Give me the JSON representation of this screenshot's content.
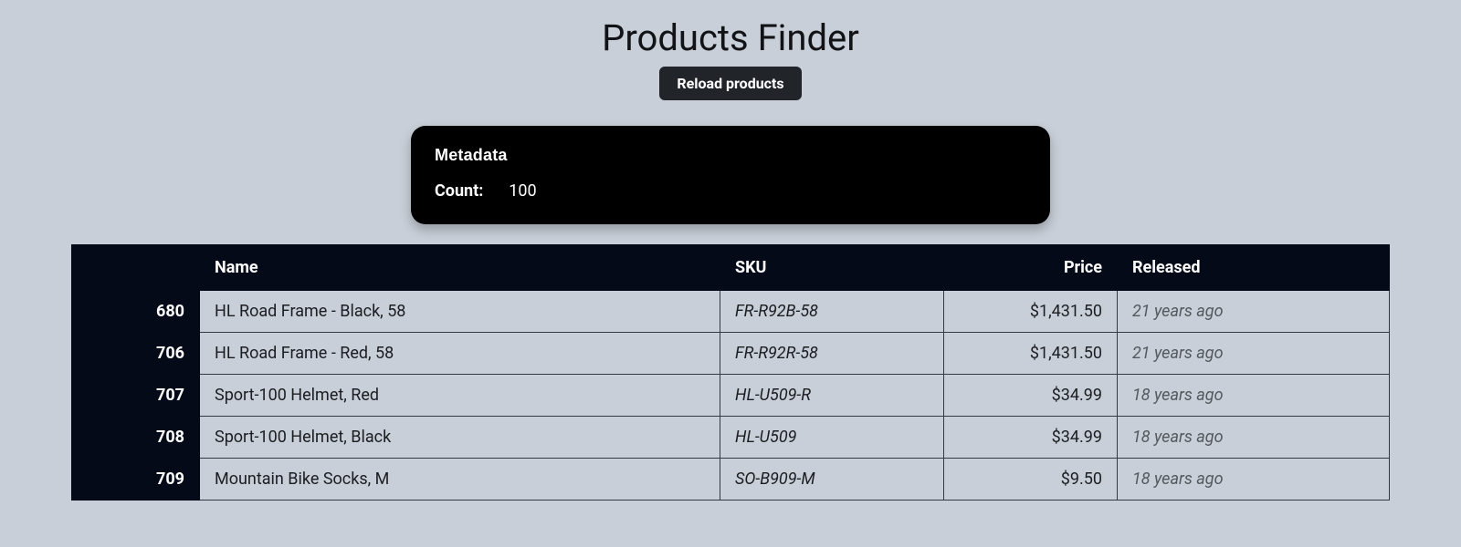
{
  "page": {
    "title": "Products Finder",
    "reload_label": "Reload products"
  },
  "metadata": {
    "heading": "Metadata",
    "count_label": "Count:",
    "count_value": "100"
  },
  "table": {
    "headers": {
      "id": "",
      "name": "Name",
      "sku": "SKU",
      "price": "Price",
      "released": "Released"
    },
    "rows": [
      {
        "id": "680",
        "name": "HL Road Frame - Black, 58",
        "sku": "FR-R92B-58",
        "price": "$1,431.50",
        "released": "21 years ago"
      },
      {
        "id": "706",
        "name": "HL Road Frame - Red, 58",
        "sku": "FR-R92R-58",
        "price": "$1,431.50",
        "released": "21 years ago"
      },
      {
        "id": "707",
        "name": "Sport-100 Helmet, Red",
        "sku": "HL-U509-R",
        "price": "$34.99",
        "released": "18 years ago"
      },
      {
        "id": "708",
        "name": "Sport-100 Helmet, Black",
        "sku": "HL-U509",
        "price": "$34.99",
        "released": "18 years ago"
      },
      {
        "id": "709",
        "name": "Mountain Bike Socks, M",
        "sku": "SO-B909-M",
        "price": "$9.50",
        "released": "18 years ago"
      }
    ]
  }
}
